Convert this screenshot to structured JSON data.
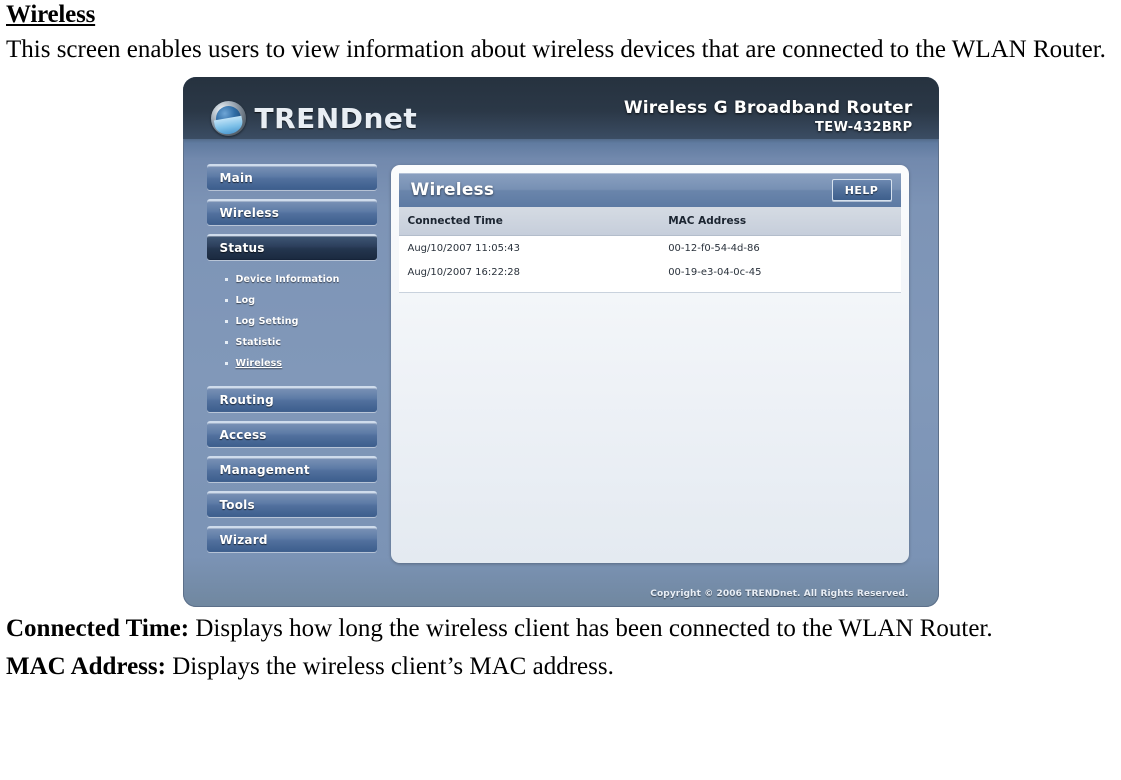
{
  "document": {
    "heading": "Wireless",
    "intro": "This screen enables users to view information about wireless devices that are connected to the WLAN Router.",
    "definitions": [
      {
        "term": "Connected Time:",
        "description": " Displays how long the wireless client has been connected to the WLAN Router."
      },
      {
        "term": "MAC Address:",
        "description": " Displays the wireless client’s MAC address."
      }
    ]
  },
  "router_ui": {
    "brand": {
      "logo_icon": "trendnet-globe-icon",
      "name_upper": "TRENDn",
      "name_lower": "eT",
      "full_name": "TRENDnet"
    },
    "product": {
      "name": "Wireless G Broadband Router",
      "model": "TEW-432BRP"
    },
    "sidebar": {
      "items": [
        {
          "label": "Main",
          "active": false
        },
        {
          "label": "Wireless",
          "active": false
        },
        {
          "label": "Status",
          "active": true
        },
        {
          "label": "Routing",
          "active": false
        },
        {
          "label": "Access",
          "active": false
        },
        {
          "label": "Management",
          "active": false
        },
        {
          "label": "Tools",
          "active": false
        },
        {
          "label": "Wizard",
          "active": false
        }
      ],
      "status_submenu": [
        {
          "label": "Device Information",
          "active": false
        },
        {
          "label": "Log",
          "active": false
        },
        {
          "label": "Log Setting",
          "active": false
        },
        {
          "label": "Statistic",
          "active": false
        },
        {
          "label": "Wireless",
          "active": true
        }
      ]
    },
    "panel": {
      "title": "Wireless",
      "help_label": "HELP",
      "table": {
        "columns": [
          "Connected Time",
          "MAC Address"
        ],
        "rows": [
          [
            "Aug/10/2007 11:05:43",
            "00-12-f0-54-4d-86"
          ],
          [
            "Aug/10/2007 16:22:28",
            "00-19-e3-04-0c-45"
          ]
        ]
      }
    },
    "footer": {
      "copyright": "Copyright © 2006 TRENDnet. All Rights Reserved."
    },
    "colors": {
      "shell_blue": "#7d94b6",
      "header_dark": "#2b3847",
      "panel_title_blue": "#6a85ab",
      "nav_button_blue": "#51709d",
      "nav_active_navy": "#24364f",
      "table_header_gray": "#c6cedb",
      "content_white": "#ffffff"
    }
  }
}
